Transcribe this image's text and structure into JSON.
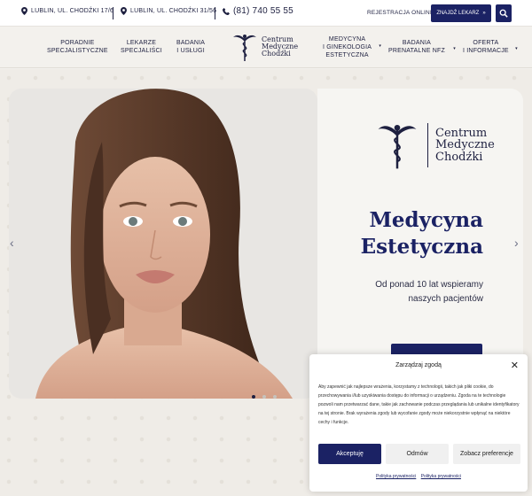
{
  "topbar": {
    "address1": "LUBLIN, UL. CHODŹKI 17/6",
    "address2": "LUBLIN, UL. CHODŹKI 31/56",
    "phone": "(81) 740 55 55",
    "registration_label": "REJESTRACJA ONLINE:",
    "find_doctor_label": "ZNAJDŹ LEKARZ",
    "find_doctor_arrow": "»"
  },
  "nav": {
    "items": [
      {
        "line1": "PORADNIE",
        "line2": "SPECJALISTYCZNE"
      },
      {
        "line1": "LEKARZE",
        "line2": "SPECJALIŚCI"
      },
      {
        "line1": "BADANIA",
        "line2": "I USŁUGI"
      },
      {
        "line1": "MEDYCYNA",
        "line2": "I GINEKOLOGIA",
        "line3": "ESTETYCZNA"
      },
      {
        "line1": "BADANIA",
        "line2": "PRENATALNE NFZ"
      },
      {
        "line1": "OFERTA",
        "line2": "I INFORMACJE"
      }
    ],
    "caret": "▾"
  },
  "logo": {
    "line1": "Centrum",
    "line2": "Medyczne",
    "line3": "Chodźki"
  },
  "hero": {
    "title_line1": "Medycyna",
    "title_line2": "Estetyczna",
    "subtitle_line1": "Od ponad 10 lat wspieramy",
    "subtitle_line2": "naszych pacjentów",
    "prev_arrow": "‹",
    "next_arrow": "›"
  },
  "consent": {
    "title": "Zarządzaj zgodą",
    "close": "✕",
    "body": "Aby zapewnić jak najlepsze wrażenia, korzystamy z technologii, takich jak pliki cookie, do przechowywania i/lub uzyskiwania dostępu do informacji o urządzeniu. Zgoda na te technologie pozwoli nam przetwarzać dane, takie jak zachowanie podczas przeglądania lub unikalne identyfikatory na tej stronie. Brak wyrażenia zgody lub wycofanie zgody może niekorzystnie wpłynąć na niektóre cechy i funkcje.",
    "accept": "Akceptuję",
    "deny": "Odmów",
    "prefs": "Zobacz preferencje",
    "link1": "Polityka prywatności",
    "link2": "Polityka prywatności"
  },
  "colors": {
    "navy": "#1b2264",
    "background": "#f3f1ed"
  }
}
